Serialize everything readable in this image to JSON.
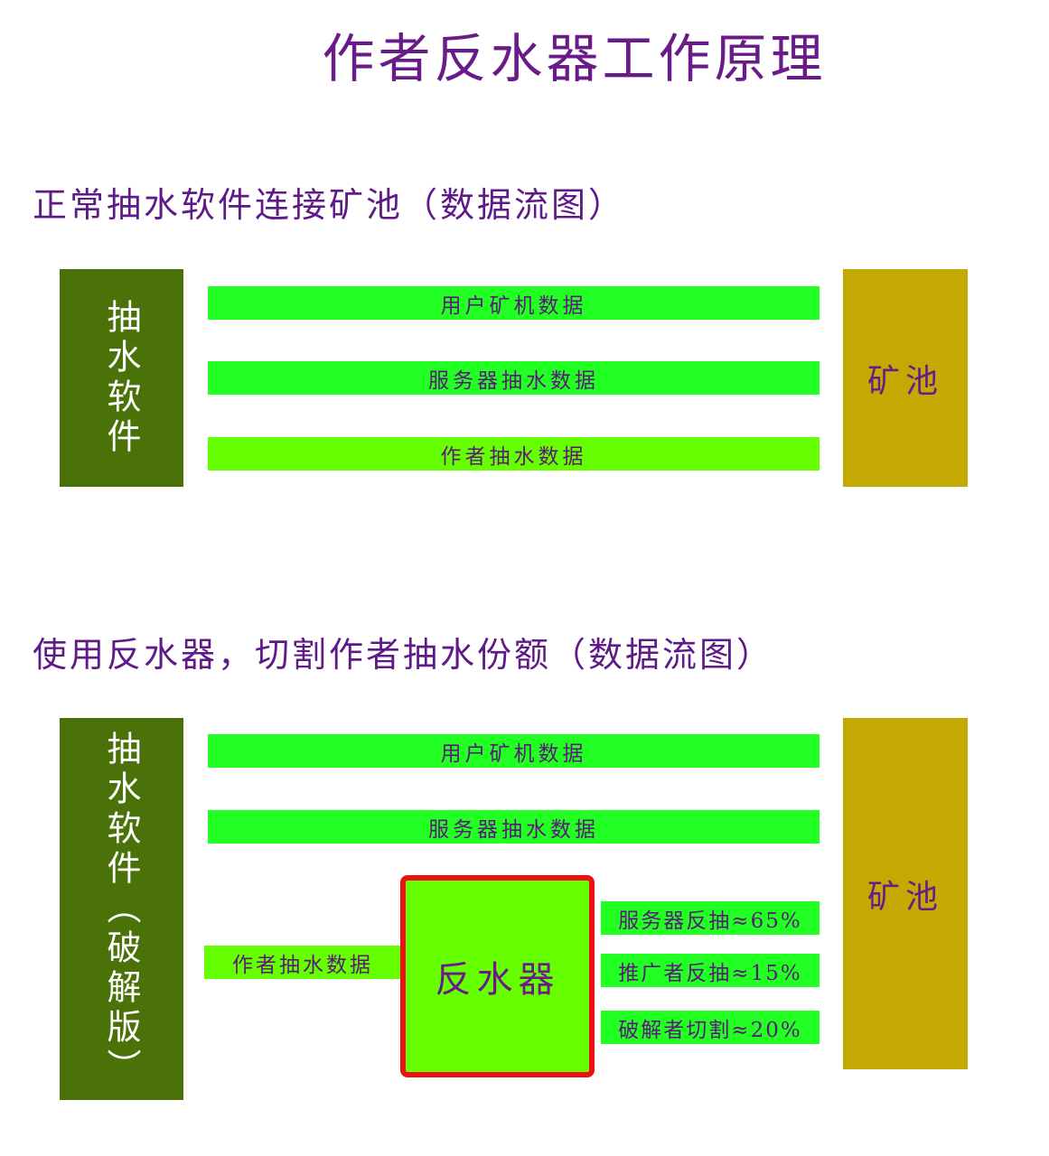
{
  "title": "作者反水器工作原理",
  "section1": {
    "heading": "正常抽水软件连接矿池（数据流图）",
    "software_label": "抽水软件",
    "pool_label": "矿池",
    "flows": [
      "用户矿机数据",
      "服务器抽水数据",
      "作者抽水数据"
    ]
  },
  "section2": {
    "heading": "使用反水器，切割作者抽水份额（数据流图）",
    "software_label": "抽水软件（破解版）",
    "pool_label": "矿池",
    "flows": [
      "用户矿机数据",
      "服务器抽水数据"
    ],
    "author_flow": "作者抽水数据",
    "reverser_label": "反水器",
    "outputs": [
      "服务器反抽≈65%",
      "推广者反抽≈15%",
      "破解者切割≈20%"
    ]
  }
}
